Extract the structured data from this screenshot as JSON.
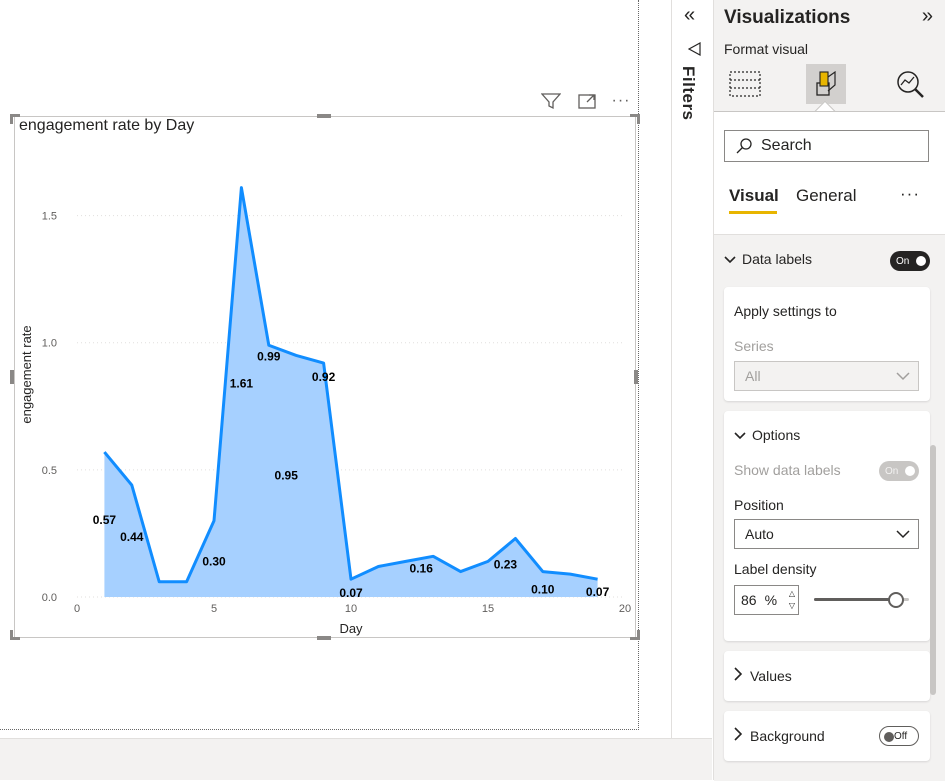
{
  "chart": {
    "title": "engagement rate by Day",
    "header_icons": [
      "filter-icon",
      "focus-mode-icon",
      "more-options-icon"
    ]
  },
  "chart_data": {
    "type": "area",
    "title": "engagement rate by Day",
    "xlabel": "Day",
    "ylabel": "engagement rate",
    "xlim": [
      0,
      20
    ],
    "ylim": [
      0,
      1.75
    ],
    "x_ticks": [
      "0",
      "5",
      "10",
      "15",
      "20"
    ],
    "y_ticks": [
      "0.0",
      "0.5",
      "1.0",
      "1.5"
    ],
    "grid": true,
    "color": "#118dff",
    "fill_color": "#a6d0ff",
    "x": [
      1,
      2,
      3,
      4,
      5,
      6,
      7,
      8,
      9,
      10,
      11,
      12,
      13,
      14,
      15,
      16,
      17,
      18,
      19
    ],
    "values": [
      0.57,
      0.44,
      0.06,
      0.06,
      0.3,
      1.61,
      0.99,
      0.95,
      0.92,
      0.07,
      0.12,
      0.14,
      0.16,
      0.1,
      0.14,
      0.23,
      0.1,
      0.09,
      0.07
    ],
    "data_labels": [
      {
        "x": 1,
        "text": "0.57"
      },
      {
        "x": 2,
        "text": "0.44"
      },
      {
        "x": 5,
        "text": "0.30"
      },
      {
        "x": 6,
        "text": "1.61"
      },
      {
        "x": 7,
        "text": "0.99"
      },
      {
        "x": 8,
        "text": "0.95"
      },
      {
        "x": 9,
        "text": "0.92"
      },
      {
        "x": 10,
        "text": "0.07"
      },
      {
        "x": 13,
        "text": "0.16"
      },
      {
        "x": 16,
        "text": "0.23"
      },
      {
        "x": 17,
        "text": "0.10"
      },
      {
        "x": 19,
        "text": "0.07"
      }
    ]
  },
  "filters": {
    "label": "Filters"
  },
  "viz_pane": {
    "title": "Visualizations",
    "subtitle": "Format visual",
    "search_placeholder": "Search",
    "tabs": {
      "visual": "Visual",
      "general": "General",
      "more": "···"
    },
    "data_labels": {
      "label": "Data labels",
      "toggle": "On"
    },
    "apply_settings": {
      "label": "Apply settings to",
      "series_label": "Series",
      "series_value": "All"
    },
    "options": {
      "label": "Options",
      "show_data_labels": "Show data labels",
      "show_toggle": "On",
      "position_label": "Position",
      "position_value": "Auto",
      "density_label": "Label density",
      "density_value": "86",
      "density_unit": "%",
      "density_level": 0.86
    },
    "values": {
      "label": "Values"
    },
    "background": {
      "label": "Background",
      "toggle": "Off"
    }
  }
}
